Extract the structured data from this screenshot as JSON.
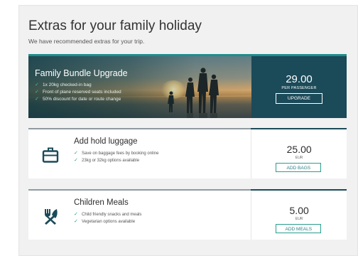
{
  "section": {
    "title": "Extras for your family holiday",
    "subtitle": "We have recommended extras for your trip."
  },
  "bundle": {
    "title": "Family Bundle Upgrade",
    "features": [
      "1x 20kg checked-in bag",
      "Front of plane reserved seats included",
      "50% discount for date or route change"
    ],
    "price": "29.00",
    "price_unit": "PER PASSENGER",
    "button_label": "UPGRADE"
  },
  "extras": [
    {
      "title": "Add hold luggage",
      "icon": "luggage-icon",
      "features": [
        "Save on baggage fees by booking online",
        "23kg or 32kg options available"
      ],
      "price": "25.00",
      "currency": "EUR",
      "button_label": "ADD BAGS"
    },
    {
      "title": "Children Meals",
      "icon": "fork-knife-icon",
      "features": [
        "Child friendly snacks and meals",
        "Vegetarian options available"
      ],
      "price": "5.00",
      "currency": "EUR",
      "button_label": "ADD MEALS"
    }
  ],
  "colors": {
    "accent": "#1c8f8c",
    "bundle_side": "#1b4a59",
    "check": "#2a9e8e",
    "panel_bg": "#f1f1f1"
  }
}
